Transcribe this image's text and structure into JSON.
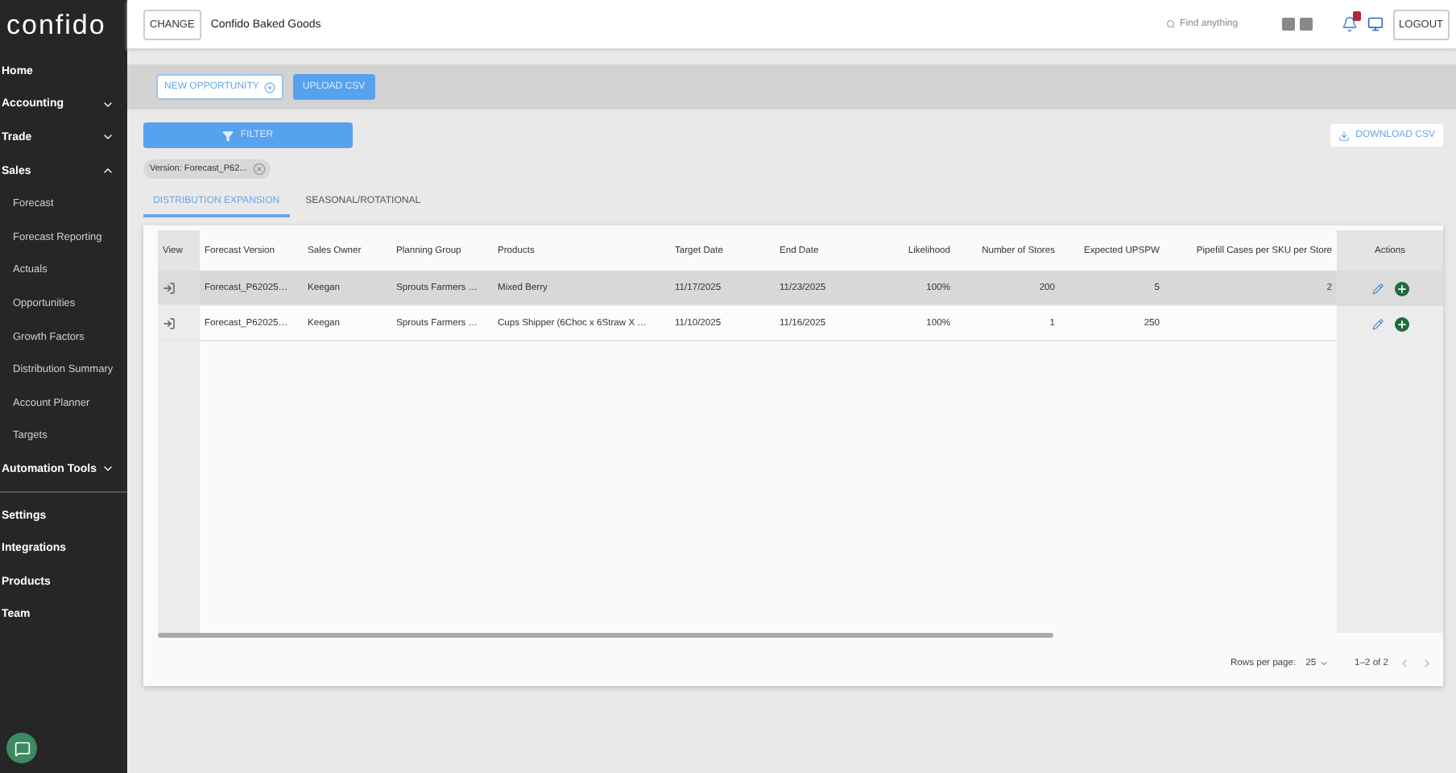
{
  "brand": {
    "logo": "confido"
  },
  "sidebar": {
    "items": [
      {
        "kind": "section",
        "label": "Home"
      },
      {
        "kind": "section",
        "label": "Accounting",
        "expanded": false
      },
      {
        "kind": "section",
        "label": "Trade",
        "expanded": false
      },
      {
        "kind": "section",
        "label": "Sales",
        "expanded": true
      },
      {
        "kind": "sub",
        "label": "Forecast"
      },
      {
        "kind": "sub",
        "label": "Forecast Reporting"
      },
      {
        "kind": "sub",
        "label": "Actuals"
      },
      {
        "kind": "sub",
        "label": "Opportunities"
      },
      {
        "kind": "sub",
        "label": "Growth Factors"
      },
      {
        "kind": "sub",
        "label": "Distribution Summary"
      },
      {
        "kind": "sub",
        "label": "Account Planner"
      },
      {
        "kind": "sub",
        "label": "Targets"
      },
      {
        "kind": "section",
        "label": "Automation Tools",
        "expanded": false
      },
      {
        "kind": "divider"
      },
      {
        "kind": "section",
        "label": "Settings"
      },
      {
        "kind": "section",
        "label": "Integrations"
      },
      {
        "kind": "section",
        "label": "Products"
      },
      {
        "kind": "section",
        "label": "Team"
      }
    ]
  },
  "header": {
    "change_button": "CHANGE",
    "company": "Confido Baked Goods",
    "search": {
      "placeholder": "Find anything"
    },
    "logout": "LOGOUT"
  },
  "toolbar": {
    "new_button": "NEW OPPORTUNITY",
    "upload_button": "UPLOAD CSV",
    "filter_button": "FILTER",
    "download_button": "DOWNLOAD CSV"
  },
  "chips": [
    {
      "label": "Version: Forecast_P62..."
    }
  ],
  "tabs": [
    {
      "label": "DISTRIBUTION EXPANSION",
      "selected": true
    },
    {
      "label": "SEASONAL/ROTATIONAL",
      "selected": false
    }
  ],
  "table": {
    "columns": [
      "View",
      "Forecast Version",
      "Sales Owner",
      "Planning Group",
      "Products",
      "Target Date",
      "End Date",
      "Likelihood",
      "Number of Stores",
      "Expected UPSPW",
      "Pipefill Cases per SKU per Store",
      "Actions"
    ],
    "rows": [
      {
        "highlighted": true,
        "cells": [
          "",
          "Forecast_P62025…",
          "Keegan",
          "Sprouts Farmers …",
          "Mixed Berry",
          "11/17/2025",
          "11/23/2025",
          "100%",
          "200",
          "5",
          "2",
          ""
        ]
      },
      {
        "highlighted": false,
        "cells": [
          "",
          "Forecast_P62025…",
          "Keegan",
          "Sprouts Farmers …",
          "Cups Shipper (6Choc x 6Straw X …",
          "11/10/2025",
          "11/16/2025",
          "100%",
          "1",
          "250",
          "",
          ""
        ]
      }
    ]
  },
  "pagination": {
    "rows_label": "Rows per page:",
    "rows_value": "25",
    "range": "1–2 of 2"
  }
}
